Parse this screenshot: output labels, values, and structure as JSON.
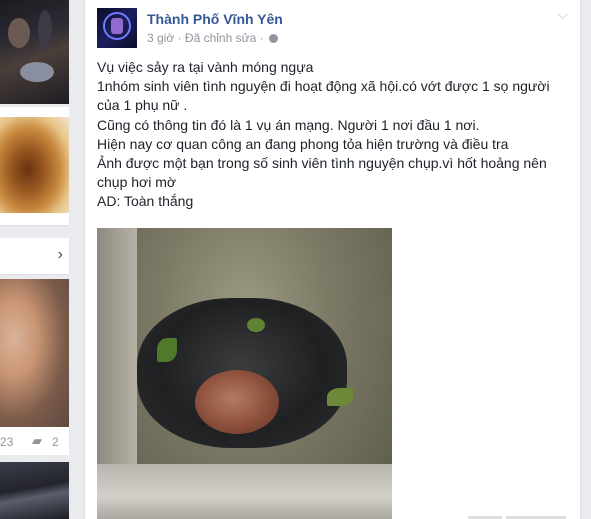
{
  "left_column": {
    "header_chevron": "chevron-right-icon",
    "stats": {
      "count_left": "23",
      "comments_icon": "comment-icon",
      "comments": "2"
    }
  },
  "post": {
    "page_name": "Thành Phố Vĩnh Yên",
    "time": "3 giờ",
    "edited": "Đã chỉnh sửa",
    "separator": "·",
    "privacy_icon": "globe-icon",
    "menu_icon": "chevron-down-icon",
    "lines": [
      "Vụ việc sảy ra tại vành móng ngựa",
      "1nhóm sinh viên tình nguyện đi hoạt động xã hội.có vớt được 1 sọ người",
      "của 1 phụ nữ .",
      "Cũng có thông tin đó là 1 vụ án mạng. Người 1 nơi đầu 1 nơi.",
      "Hiện nay cơ quan công an đang phong tỏa hiện trường và điều tra",
      "Ảnh được một bạn trong số sinh viên tình nguyện chụp.vì hốt hoảng nên",
      "chụp hơi mờ",
      "AD: Toàn thắng"
    ]
  }
}
